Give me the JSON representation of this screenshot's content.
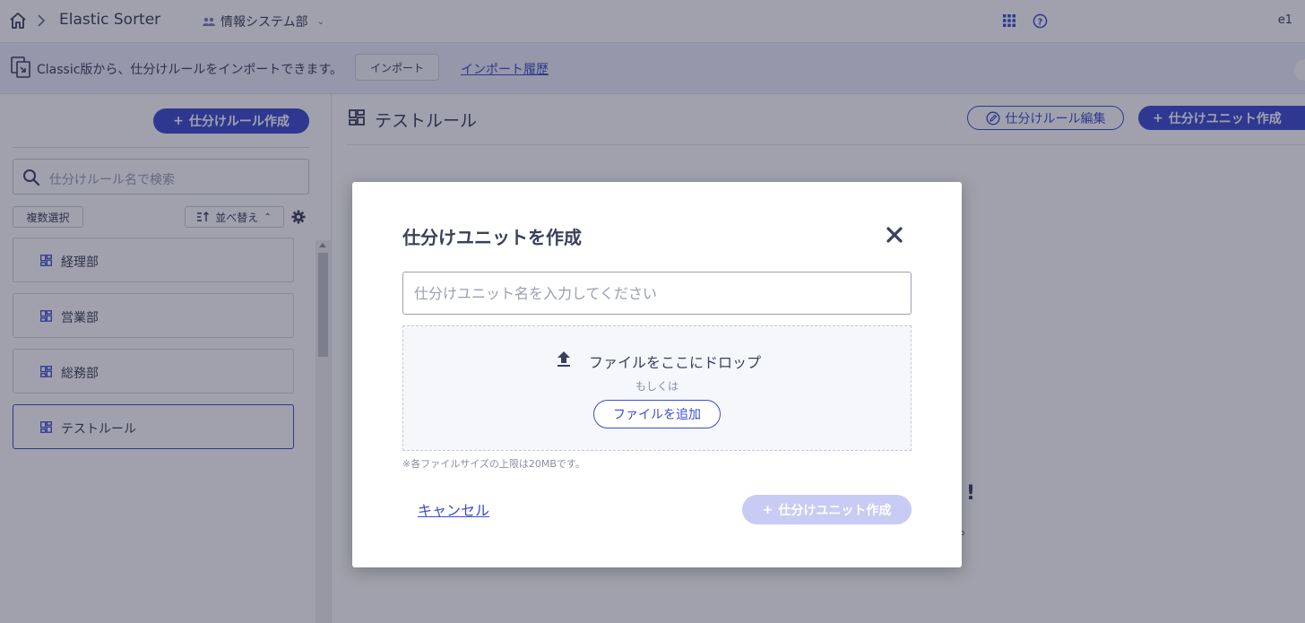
{
  "header": {
    "app_name": "Elastic Sorter",
    "org_name": "情報システム部",
    "user_label": "e1"
  },
  "banner": {
    "message": "Classic版から、仕分けルールをインポートできます。",
    "import_button": "インポート",
    "history_link": "インポート履歴"
  },
  "sidebar": {
    "create_rule_button": "仕分けルール作成",
    "search_placeholder": "仕分けルール名で検索",
    "multi_select_button": "複数選択",
    "sort_button": "並べ替え",
    "rules": [
      {
        "label": "経理部",
        "active": false
      },
      {
        "label": "営業部",
        "active": false
      },
      {
        "label": "総務部",
        "active": false
      },
      {
        "label": "テストルール",
        "active": true
      }
    ]
  },
  "main": {
    "title": "テストルール",
    "edit_rule_button": "仕分けルール編集",
    "create_unit_button": "仕分けユニット作成",
    "empty_heading_fragment": "!",
    "empty_sub_fragment": "。"
  },
  "modal": {
    "title": "仕分けユニットを作成",
    "name_placeholder": "仕分けユニット名を入力してください",
    "drop_text": "ファイルをここにドロップ",
    "or_text": "もしくは",
    "add_file_button": "ファイルを追加",
    "size_note": "※各ファイルサイズの上限は20MBです。",
    "cancel_link": "キャンセル",
    "submit_button": "仕分けユニット作成",
    "submit_enabled": false
  },
  "colors": {
    "accent": "#3c4bd1",
    "accent_disabled": "#c8cbf3",
    "text": "#3a3f5c",
    "banner_bg": "#eceefb"
  },
  "icons": {
    "home": "home-icon",
    "org": "people-icon",
    "apps": "grid-icon",
    "help": "help-icon",
    "import": "import-icon",
    "search": "search-icon",
    "settings": "gear-icon",
    "rule": "dashboard-icon",
    "close": "close-icon",
    "upload": "upload-icon",
    "edit": "edit-icon",
    "plus": "plus-icon"
  }
}
